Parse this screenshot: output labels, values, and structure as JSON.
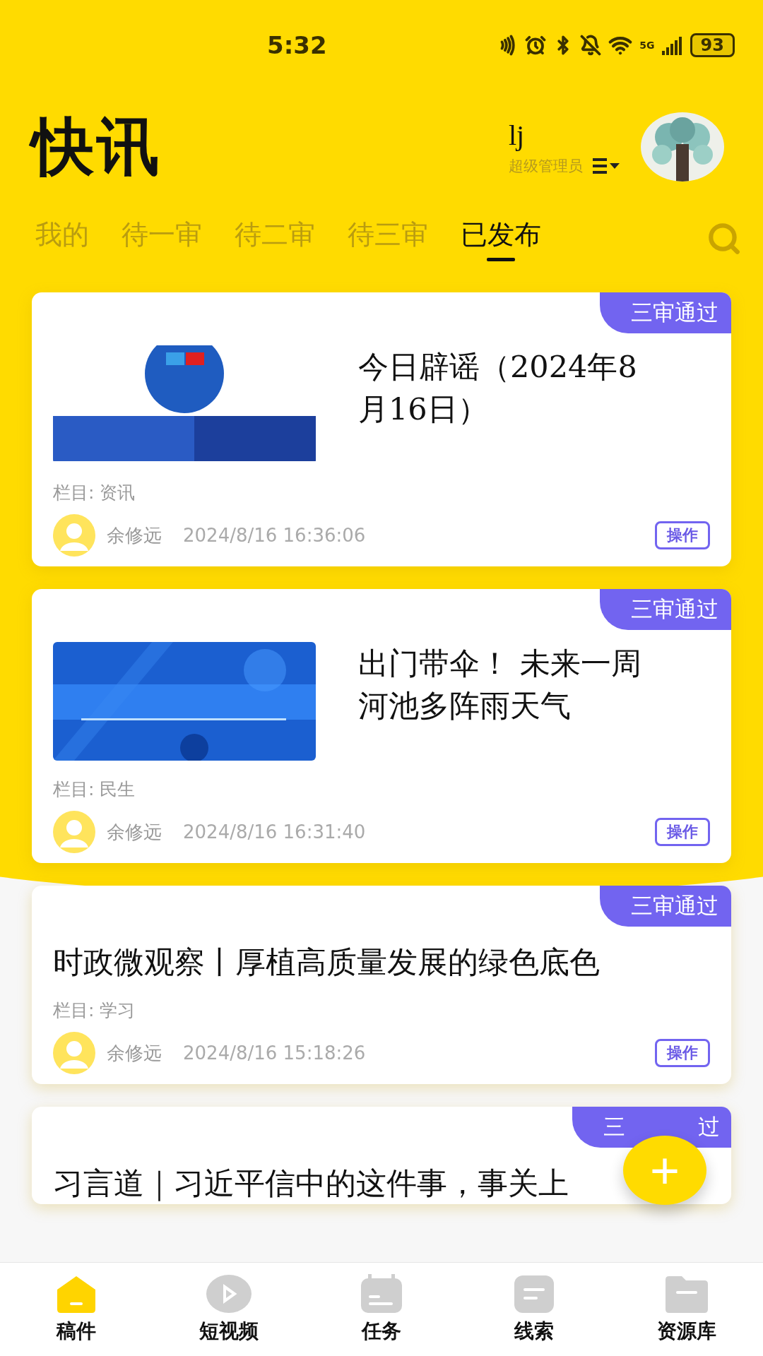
{
  "status_bar": {
    "time": "5:32",
    "network": "5G",
    "battery": "93"
  },
  "header": {
    "logo": "快讯",
    "user_name": "lj",
    "role": "超级管理员"
  },
  "tabs": [
    {
      "label": "我的",
      "selected": false
    },
    {
      "label": "待一审",
      "selected": false
    },
    {
      "label": "待二审",
      "selected": false
    },
    {
      "label": "待三审",
      "selected": false
    },
    {
      "label": "已发布",
      "selected": true
    }
  ],
  "articles": [
    {
      "badge": "三审通过",
      "title": "今日辟谣（2024年8月16日）",
      "column": "栏目: 资讯",
      "author": "余修远",
      "time": "2024/8/16 16:36:06",
      "action": "操作"
    },
    {
      "badge": "三审通过",
      "title": "出门带伞！ 未来一周河池多阵雨天气",
      "column": "栏目: 民生",
      "author": "余修远",
      "time": "2024/8/16 16:31:40",
      "action": "操作"
    },
    {
      "kind": "text",
      "badge": "三审通过",
      "title": "时政微观察丨厚植高质量发展的绿色底色",
      "column": "栏目: 学习",
      "author": "余修远",
      "time": "2024/8/16 15:18:26",
      "action": "操作"
    },
    {
      "kind": "partial",
      "badge_parts": [
        "三",
        "过"
      ],
      "title": "习言道｜习近平信中的这件事，事关上"
    }
  ],
  "fab": "+",
  "nav": [
    {
      "label": "稿件",
      "selected": true
    },
    {
      "label": "短视频",
      "selected": false
    },
    {
      "label": "任务",
      "selected": false
    },
    {
      "label": "线索",
      "selected": false
    },
    {
      "label": "资源库",
      "selected": false
    }
  ]
}
